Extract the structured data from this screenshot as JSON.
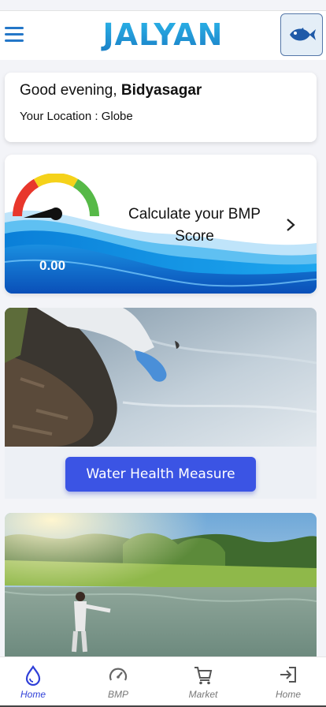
{
  "header": {
    "logo_text": "JALYAN",
    "menu_icon": "hamburger-menu-icon",
    "fish_icon": "fish-icon"
  },
  "greeting": {
    "prefix": "Good evening, ",
    "name": "Bidyasagar",
    "location_label": "Your Location : Globe"
  },
  "bmp_card": {
    "title": "Calculate your BMP Score",
    "score": "0.00",
    "gauge_icon": "gauge-meter-icon",
    "chevron_icon": "chevron-right-icon"
  },
  "water_section": {
    "button_label": "Water Health Measure"
  },
  "bottom_nav": {
    "items": [
      {
        "label": "Home",
        "icon": "water-drop-icon",
        "active": true
      },
      {
        "label": "BMP",
        "icon": "speedometer-icon",
        "active": false
      },
      {
        "label": "Market",
        "icon": "cart-icon",
        "active": false
      },
      {
        "label": "Home",
        "icon": "login-icon",
        "active": false
      }
    ]
  },
  "colors": {
    "accent": "#3b54e4",
    "logo_blue": "#1c9ad6",
    "nav_active": "#2f3fd8"
  }
}
